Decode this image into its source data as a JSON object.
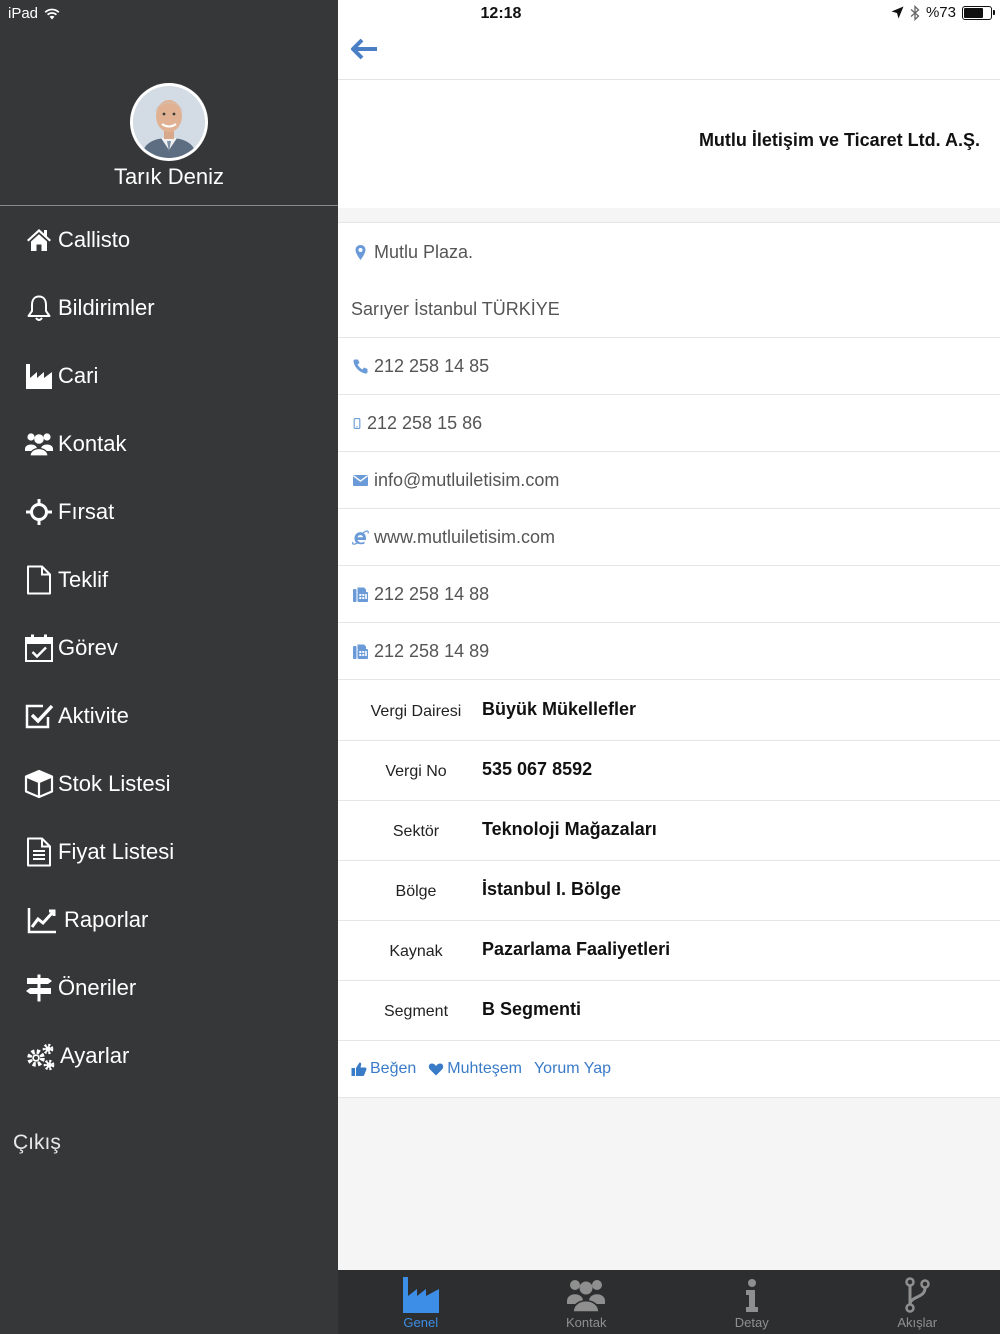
{
  "status_bar": {
    "device": "iPad",
    "time": "12:18",
    "battery": "%73",
    "battery_level": 0.73
  },
  "sidebar": {
    "user_name": "Tarık Deniz",
    "items": [
      {
        "label": "Callisto",
        "icon": "home-icon"
      },
      {
        "label": "Bildirimler",
        "icon": "bell-icon"
      },
      {
        "label": "Cari",
        "icon": "factory-icon"
      },
      {
        "label": "Kontak",
        "icon": "users-icon"
      },
      {
        "label": "Fırsat",
        "icon": "crosshair-icon"
      },
      {
        "label": "Teklif",
        "icon": "file-icon"
      },
      {
        "label": "Görev",
        "icon": "calendar-check-icon"
      },
      {
        "label": "Aktivite",
        "icon": "checkbox-icon"
      },
      {
        "label": "Stok Listesi",
        "icon": "cube-icon"
      },
      {
        "label": "Fiyat Listesi",
        "icon": "file-text-icon"
      },
      {
        "label": "Raporlar",
        "icon": "line-chart-icon"
      },
      {
        "label": "Öneriler",
        "icon": "signpost-icon"
      },
      {
        "label": "Ayarlar",
        "icon": "gears-icon"
      }
    ],
    "logout": "Çıkış"
  },
  "company": {
    "name": "Mutlu İletişim ve Ticaret Ltd. A.Ş.",
    "address_line1": "Mutlu Plaza.",
    "address_line2": "Sarıyer İstanbul TÜRKİYE",
    "phone": "212 258 14 85",
    "mobile": "212 258 15 86",
    "email": "info@mutluiletisim.com",
    "website": "www.mutluiletisim.com",
    "fax1": "212 258 14 88",
    "fax2": "212 258 14 89"
  },
  "details": [
    {
      "label": "Vergi Dairesi",
      "value": "Büyük Mükellefler"
    },
    {
      "label": "Vergi No",
      "value": "535 067 8592"
    },
    {
      "label": "Sektör",
      "value": "Teknoloji Mağazaları"
    },
    {
      "label": "Bölge",
      "value": "İstanbul I. Bölge"
    },
    {
      "label": "Kaynak",
      "value": "Pazarlama Faaliyetleri"
    },
    {
      "label": "Segment",
      "value": "B Segmenti"
    }
  ],
  "actions": {
    "like": "Beğen",
    "awesome": "Muhteşem",
    "comment": "Yorum Yap"
  },
  "tabs": [
    {
      "label": "Genel",
      "icon": "factory-icon",
      "active": true
    },
    {
      "label": "Kontak",
      "icon": "users-icon",
      "active": false
    },
    {
      "label": "Detay",
      "icon": "info-icon",
      "active": false
    },
    {
      "label": "Akışlar",
      "icon": "branch-icon",
      "active": false
    }
  ],
  "colors": {
    "sidebar_bg": "#363738",
    "accent": "#3d8ee6",
    "link": "#3a7bc8",
    "icon_blue": "#6a9bd8",
    "tab_bar_bg": "#2d2e2f"
  }
}
